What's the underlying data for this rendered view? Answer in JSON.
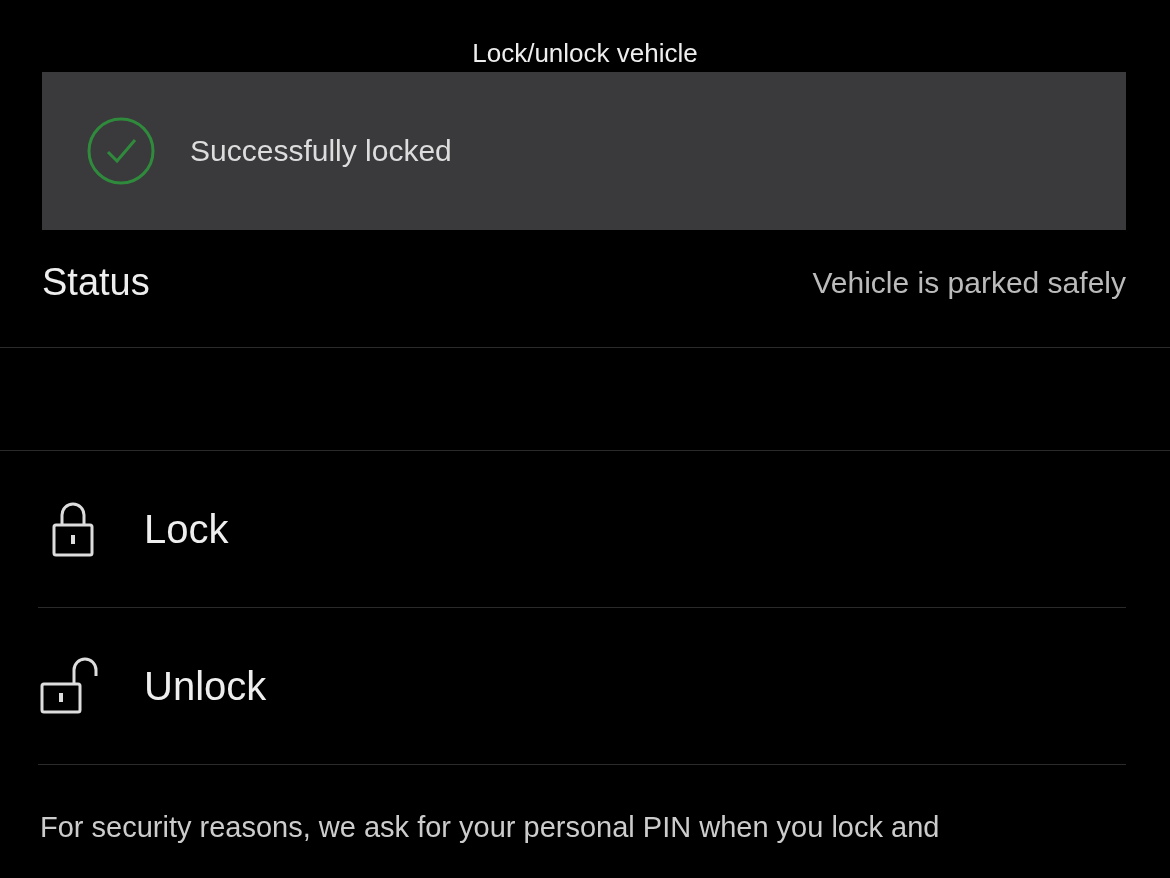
{
  "header": {
    "title": "Lock/unlock vehicle"
  },
  "toast": {
    "kind": "success",
    "message": "Successfully locked"
  },
  "status": {
    "label": "Status",
    "value": "Vehicle is parked safely"
  },
  "actions": [
    {
      "kind": "lock",
      "label": "Lock"
    },
    {
      "kind": "unlock",
      "label": "Unlock"
    }
  ],
  "note": "For security reasons, we ask for your personal PIN when you lock and"
}
